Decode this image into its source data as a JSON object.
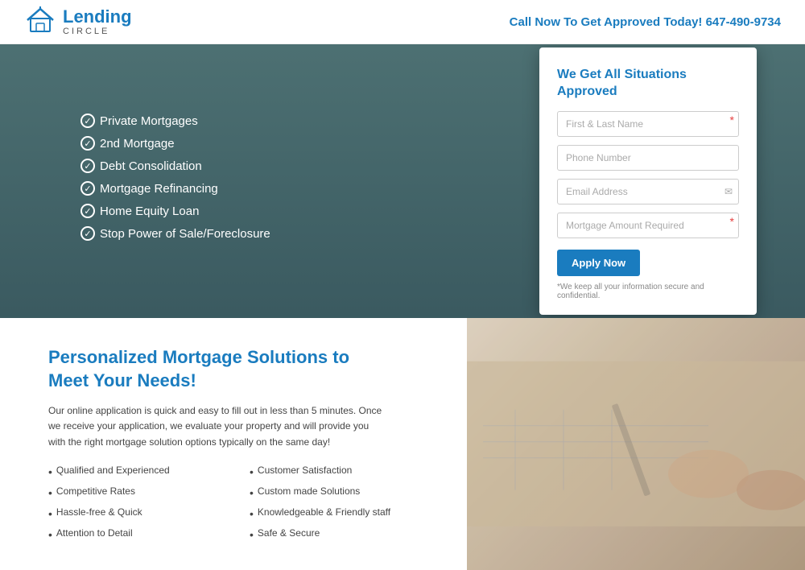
{
  "header": {
    "logo_lending": "Lending",
    "logo_circle": "CIRCLE",
    "call_text": "Call Now To Get Approved Today!",
    "phone": "647-490-9734"
  },
  "hero": {
    "list_items": [
      "Private Mortgages",
      "2nd Mortgage",
      "Debt Consolidation",
      "Mortgage Refinancing",
      "Home Equity Loan",
      "Stop Power of Sale/Foreclosure"
    ],
    "form": {
      "title": "We Get All Situations Approved",
      "field1_placeholder": "First & Last Name",
      "field2_placeholder": "Phone Number",
      "field3_placeholder": "Email Address",
      "field4_placeholder": "Mortgage Amount Required",
      "apply_label": "Apply Now",
      "privacy_text": "*We keep all your information secure and confidential."
    }
  },
  "lower": {
    "title_line1": "Personalized Mortgage Solutions to",
    "title_line2": "Meet Your Needs!",
    "description": "Our online application is quick and easy to fill out in less than 5 minutes. Once we receive your application, we evaluate your property and will provide you with the right mortgage solution options typically on the same day!",
    "features": [
      "Qualified and Experienced",
      "Competitive Rates",
      "Hassle-free & Quick",
      "Attention to Detail",
      "Customer Satisfaction",
      "Custom made Solutions",
      "Knowledgeable & Friendly staff",
      "Safe & Secure"
    ]
  }
}
